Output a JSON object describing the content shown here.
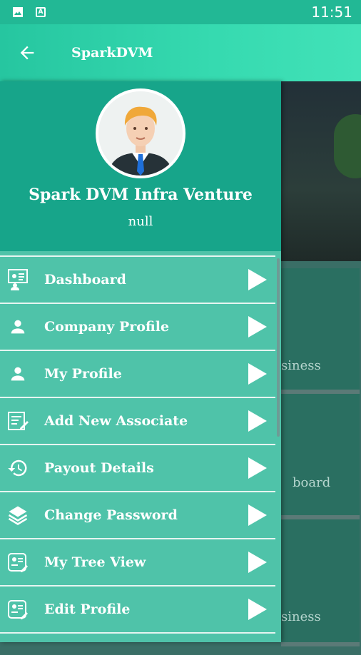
{
  "status": {
    "time": "11:51",
    "icons": [
      "image-icon",
      "a-letter-icon"
    ],
    "a_letter": "A"
  },
  "app_bar": {
    "title": "SparkDVM",
    "back_icon": "arrow-left-icon"
  },
  "background": {
    "card_texts": [
      "siness",
      "board",
      "siness"
    ]
  },
  "drawer": {
    "name": "Spark DVM Infra Venture",
    "subtitle": "null",
    "items": [
      {
        "label": "Dashboard",
        "icon": "dashboard-icon"
      },
      {
        "label": "Company Profile",
        "icon": "person-icon"
      },
      {
        "label": "My Profile",
        "icon": "person-icon"
      },
      {
        "label": "Add New Associate",
        "icon": "add-associate-icon"
      },
      {
        "label": "Payout Details",
        "icon": "history-icon"
      },
      {
        "label": "Change Password",
        "icon": "layers-icon"
      },
      {
        "label": "My Tree View",
        "icon": "id-card-edit-icon"
      },
      {
        "label": "Edit Profile",
        "icon": "id-card-edit-icon"
      }
    ]
  },
  "colors": {
    "header": "#17a58a",
    "drawer": "#4fc3a9",
    "app_bar": "#26c6a0"
  }
}
